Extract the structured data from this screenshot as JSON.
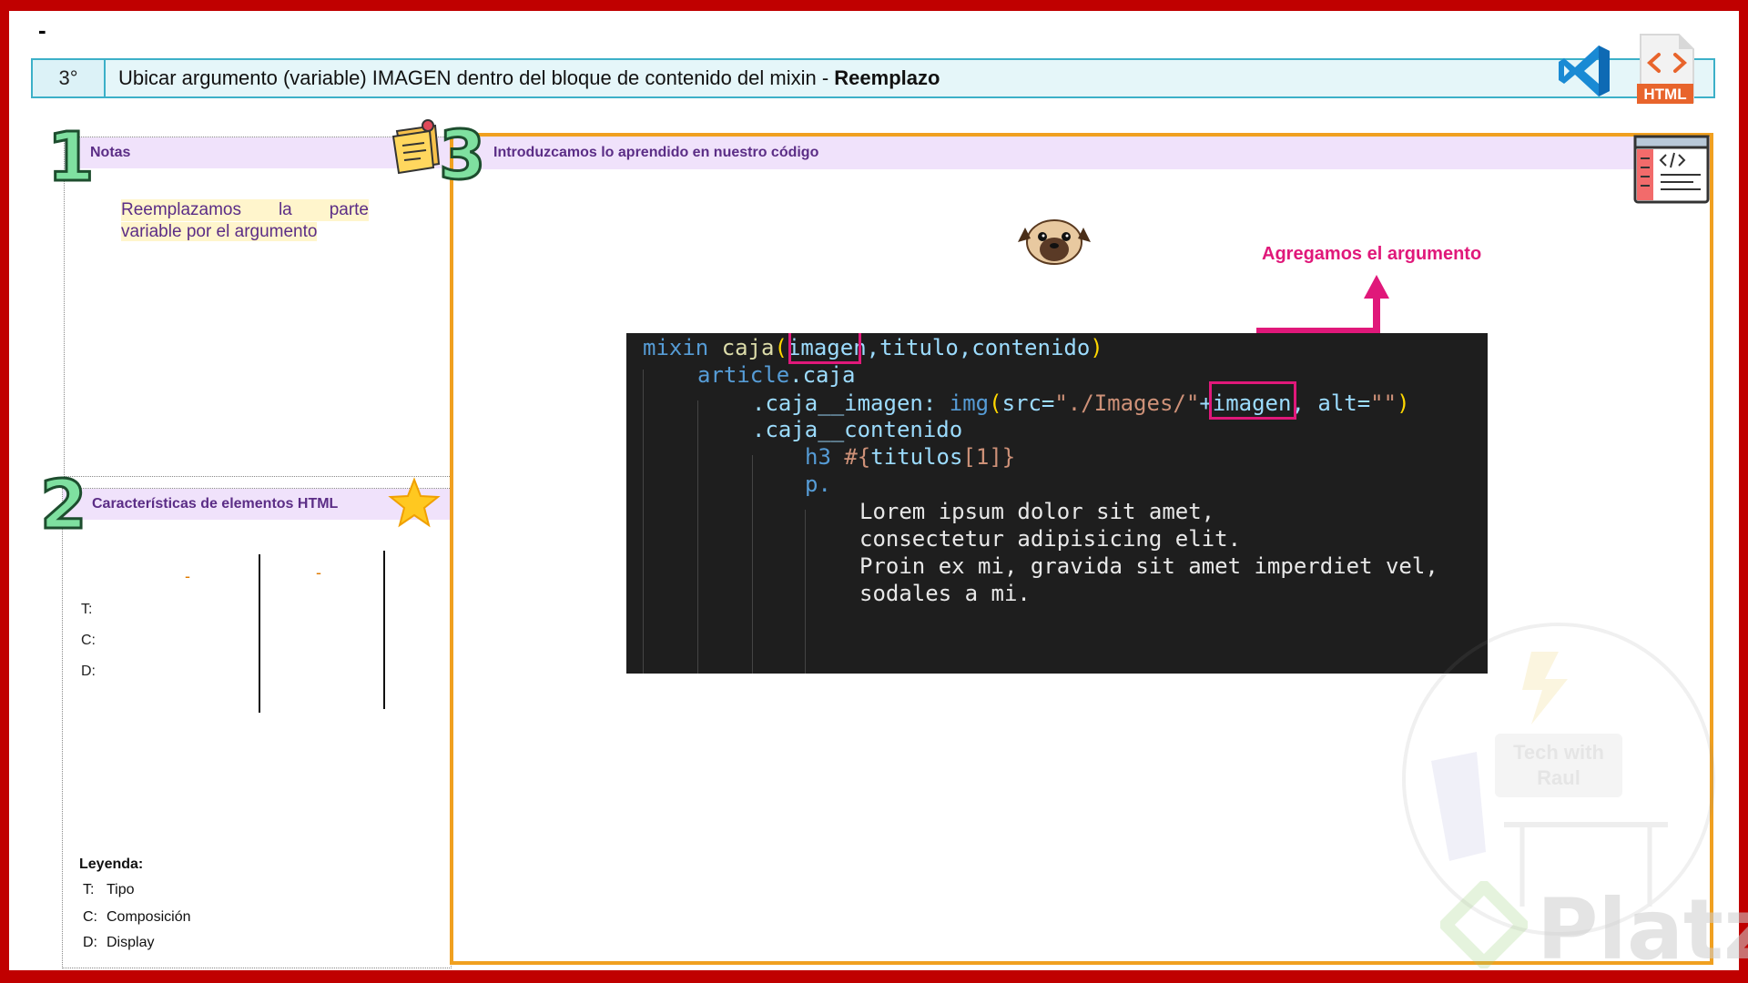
{
  "top_dash": "-",
  "header": {
    "step": "3°",
    "title_main": "Ubicar argumento (variable) IMAGEN dentro del bloque de contenido del mixin - ",
    "title_bold": "Reemplazo",
    "html_badge": "HTML"
  },
  "panel1": {
    "number": "1",
    "title": "Notas",
    "note_line1": "Reemplazamos la parte",
    "note_line2": "variable por el argumento"
  },
  "panel2": {
    "number": "2",
    "title": "Características de elementos HTML",
    "dash_a": "-",
    "dash_b": "-",
    "labels": [
      "T:",
      "C:",
      "D:"
    ],
    "legend_title": "Leyenda:",
    "legend": [
      {
        "key": "T:",
        "value": "Tipo"
      },
      {
        "key": "C:",
        "value": "Composición"
      },
      {
        "key": "D:",
        "value": "Display"
      }
    ]
  },
  "panel3": {
    "number": "3",
    "title": "Introduzcamos lo aprendido en nuestro código",
    "annotation": "Agregamos el argumento"
  },
  "code": {
    "l1": {
      "kw": "mixin ",
      "fn": "caja",
      "p1": "(",
      "a1": "imagen",
      "rest": ",titulo,contenido",
      "p2": ")"
    },
    "l2": {
      "a": "article",
      "b": ".caja"
    },
    "l3": {
      "a": ".caja__imagen: ",
      "b": "img",
      "c": "(",
      "d": "src=",
      "e": "\"./Images/\"",
      "f": "+imagen",
      "g": ", alt=",
      "h": "\"\"",
      "i": ")"
    },
    "l4": {
      "a": ".caja__contenido"
    },
    "l5": {
      "a": "h3 ",
      "b": "#{",
      "c": "titulos",
      "d": "[1]",
      "e": "}"
    },
    "l6": {
      "a": "p."
    },
    "l7": "Lorem ipsum dolor sit amet,",
    "l8": "consectetur adipisicing elit.",
    "l9": "Proin ex mi, gravida sit amet imperdiet vel,",
    "l10": "sodales a mi."
  },
  "watermark": {
    "text1": "Tech with",
    "text2": "Raul",
    "brand": "Platzi"
  },
  "colors": {
    "frame": "#c00000",
    "accent_pink": "#e0187a",
    "panel_orange": "#f0a020",
    "header_teal": "#3cb0c8",
    "panel_head_lavender": "#f0e2fb"
  }
}
